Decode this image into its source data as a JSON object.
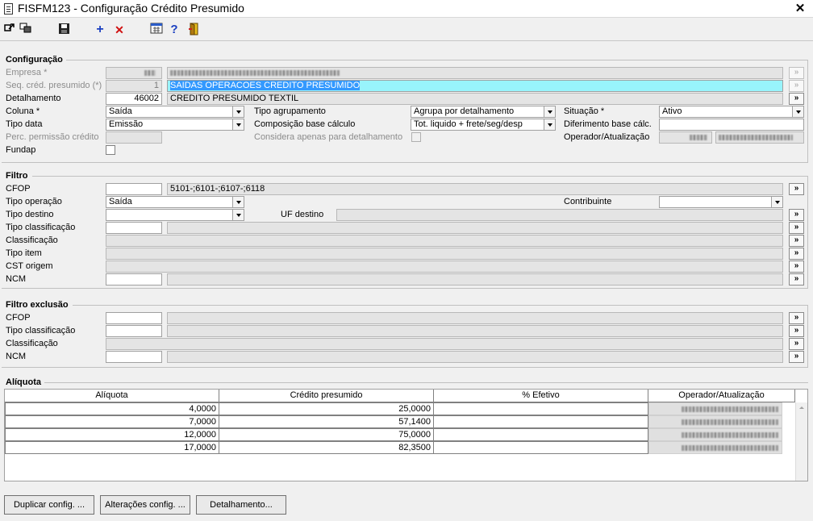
{
  "window": {
    "title": "FISFM123 - Configuração Crédito Presumido",
    "close_label": "✕"
  },
  "toolbar": {
    "icons": [
      "arrow-out-icon",
      "window-icon",
      "save-icon",
      "add-icon",
      "delete-icon",
      "calculator-icon",
      "help-icon",
      "exit-door-icon"
    ],
    "add_glyph": "+",
    "delete_glyph": "✕",
    "help_glyph": "?"
  },
  "configuracao": {
    "title": "Configuração",
    "empresa_label": "Empresa *",
    "seq_label": "Seq. créd. presumido (*)",
    "seq_value": "1",
    "seq_desc": "SAIDAS OPERACOES CREDITO PRESUMIDO",
    "detalhamento_label": "Detalhamento",
    "detalhamento_value": "46002",
    "detalhamento_desc": "CREDITO PRESUMIDO TEXTIL",
    "coluna_label": "Coluna *",
    "coluna_value": "Saída",
    "tipo_data_label": "Tipo data",
    "tipo_data_value": "Emissão",
    "perc_label": "Perc. permissão crédito",
    "fundap_label": "Fundap",
    "tipo_agrupamento_label": "Tipo agrupamento",
    "tipo_agrupamento_value": "Agrupa por detalhamento",
    "composicao_label": "Composição base cálculo",
    "composicao_value": "Tot. liquido + frete/seg/desp",
    "considera_label": "Considera apenas para detalhamento",
    "situacao_label": "Situação *",
    "situacao_value": "Ativo",
    "diferimento_label": "Diferimento base cálc.",
    "operador_label": "Operador/Atualização"
  },
  "filtro": {
    "title": "Filtro",
    "cfop_label": "CFOP",
    "cfop_list": "5101-;6101-;6107-;6118",
    "tipo_operacao_label": "Tipo operação",
    "tipo_operacao_value": "Saída",
    "contribuinte_label": "Contribuinte",
    "tipo_destino_label": "Tipo destino",
    "uf_destino_label": "UF destino",
    "tipo_classificacao_label": "Tipo classificação",
    "classificacao_label": "Classificação",
    "tipo_item_label": "Tipo item",
    "cst_origem_label": "CST origem",
    "ncm_label": "NCM"
  },
  "filtro_exclusao": {
    "title": "Filtro exclusão",
    "cfop_label": "CFOP",
    "tipo_classificacao_label": "Tipo classificação",
    "classificacao_label": "Classificação",
    "ncm_label": "NCM"
  },
  "aliquota": {
    "title": "Alíquota",
    "columns": [
      "Alíquota",
      "Crédito presumido",
      "% Efetivo",
      "Operador/Atualização"
    ],
    "rows": [
      {
        "aliquota": "4,0000",
        "credito": "25,0000",
        "efetivo": ""
      },
      {
        "aliquota": "7,0000",
        "credito": "57,1400",
        "efetivo": ""
      },
      {
        "aliquota": "12,0000",
        "credito": "75,0000",
        "efetivo": ""
      },
      {
        "aliquota": "17,0000",
        "credito": "82,3500",
        "efetivo": ""
      }
    ]
  },
  "buttons": {
    "duplicar": "Duplicar config. ...",
    "alteracoes": "Alterações config. ...",
    "detalhamento": "Detalhamento..."
  },
  "more_glyph": "»"
}
